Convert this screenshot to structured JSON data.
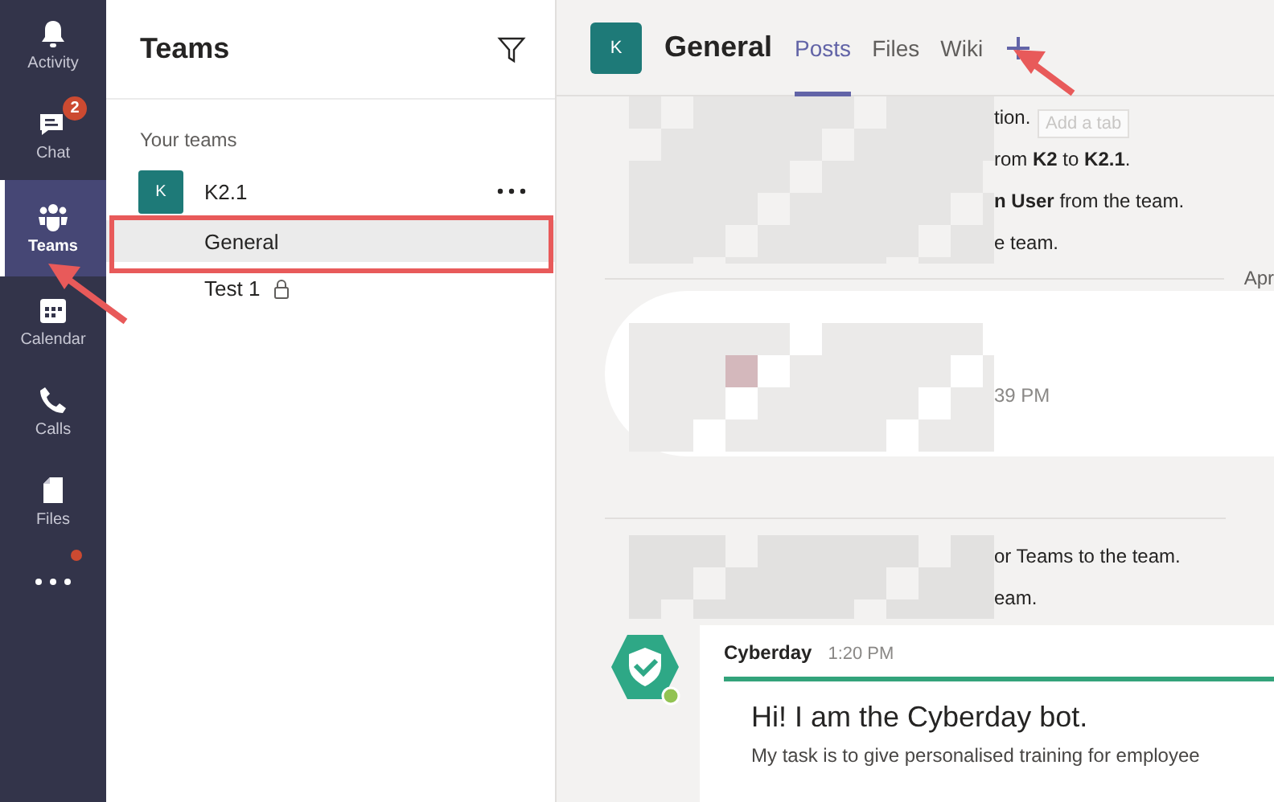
{
  "rail": {
    "items": [
      {
        "kind": "activity",
        "label": "Activity",
        "selected": false
      },
      {
        "kind": "chat",
        "label": "Chat",
        "selected": false,
        "badge": "2"
      },
      {
        "kind": "teams",
        "label": "Teams",
        "selected": true
      },
      {
        "kind": "calendar",
        "label": "Calendar",
        "selected": false
      },
      {
        "kind": "calls",
        "label": "Calls",
        "selected": false
      },
      {
        "kind": "files",
        "label": "Files",
        "selected": false
      }
    ],
    "more": {
      "notification": true
    }
  },
  "teams_panel": {
    "title": "Teams",
    "section": "Your teams",
    "teams": [
      {
        "avatar": "K",
        "name": "K2.1",
        "channels": [
          {
            "name": "General",
            "selected": true,
            "private": false
          },
          {
            "name": "Test 1",
            "selected": false,
            "private": true
          }
        ]
      }
    ]
  },
  "channel_header": {
    "avatar": "K",
    "title": "General",
    "tabs": [
      {
        "label": "Posts",
        "selected": true
      },
      {
        "label": "Files",
        "selected": false
      },
      {
        "label": "Wiki",
        "selected": false
      }
    ],
    "add_tab_tooltip": "Add a tab"
  },
  "feed": [
    {
      "kind": "system",
      "lines": [
        "tion.",
        "rom **K2** to **K2.1**.",
        "**n User** from the team.",
        "e team."
      ]
    },
    {
      "kind": "date",
      "label": "Apr"
    },
    {
      "kind": "message",
      "time": "39 PM"
    },
    {
      "kind": "divider"
    },
    {
      "kind": "system",
      "lines": [
        "or Teams to the team.",
        "eam."
      ]
    },
    {
      "kind": "bot",
      "author": "Cyberday",
      "time": "1:20 PM",
      "heading": "Hi! I am the Cyberday bot.",
      "text": "My task is to give personalised training for employee"
    }
  ]
}
